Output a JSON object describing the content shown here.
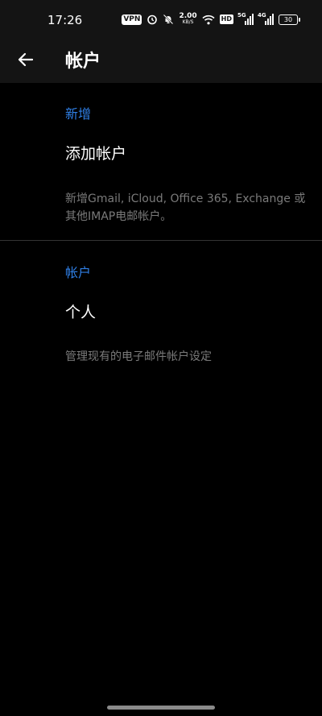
{
  "status_bar": {
    "time": "17:26",
    "vpn": "VPN",
    "speed_value": "2.00",
    "speed_unit": "KB/S",
    "hd": "HD",
    "sig1": "5G",
    "sig2": "4G",
    "battery": "30"
  },
  "toolbar": {
    "title": "帐户"
  },
  "sections": [
    {
      "label": "新增",
      "title": "添加帐户",
      "description": "新增Gmail, iCloud, Office 365, Exchange 或其他IMAP电邮帐户。"
    },
    {
      "label": "帐户",
      "title": "个人",
      "description": "管理现有的电子邮件帐户设定"
    }
  ],
  "colors": {
    "accent": "#2f7fe5",
    "background": "#000000",
    "bar": "#141414"
  }
}
